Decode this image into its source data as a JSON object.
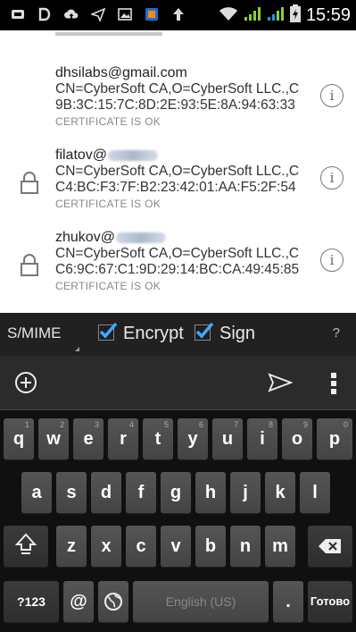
{
  "status_bar": {
    "time": "15:59"
  },
  "certificates": [
    {
      "email_prefix": "dhsilabs@gmail.com",
      "email_redacted": false,
      "has_lock": false,
      "cn": "CN=CyberSoft CA,O=CyberSoft LLC.,C",
      "fingerprint": "9B:3C:15:7C:8D:2E:93:5E:8A:94:63:33",
      "status": "CERTIFICATE IS OK"
    },
    {
      "email_prefix": "filatov@",
      "email_redacted": true,
      "has_lock": true,
      "cn": "CN=CyberSoft CA,O=CyberSoft LLC.,C",
      "fingerprint": "C4:BC:F3:7F:B2:23:42:01:AA:F5:2F:54",
      "status": "CERTIFICATE IS OK"
    },
    {
      "email_prefix": "zhukov@",
      "email_redacted": true,
      "has_lock": true,
      "cn": "CN=CyberSoft CA,O=CyberSoft LLC.,C",
      "fingerprint": "C6:9C:67:C1:9D:29:14:BC:CA:49:45:85",
      "status": "CERTIFICATE IS OK"
    }
  ],
  "smime_bar": {
    "mode_label": "S/MIME",
    "encrypt_label": "Encrypt",
    "encrypt_checked": true,
    "sign_label": "Sign",
    "sign_checked": true,
    "help_label": "?"
  },
  "keyboard": {
    "row1": [
      {
        "label": "q",
        "num": "1"
      },
      {
        "label": "w",
        "num": "2"
      },
      {
        "label": "e",
        "num": "3"
      },
      {
        "label": "r",
        "num": "4"
      },
      {
        "label": "t",
        "num": "5"
      },
      {
        "label": "y",
        "num": "6"
      },
      {
        "label": "u",
        "num": "7"
      },
      {
        "label": "i",
        "num": "8"
      },
      {
        "label": "o",
        "num": "9"
      },
      {
        "label": "p",
        "num": "0"
      }
    ],
    "row2": [
      "a",
      "s",
      "d",
      "f",
      "g",
      "h",
      "j",
      "k",
      "l"
    ],
    "row3": [
      "z",
      "x",
      "c",
      "v",
      "b",
      "n",
      "m"
    ],
    "key_123": "?123",
    "key_at": "@",
    "space_label": "English (US)",
    "key_period": ".",
    "done_label": "Готово"
  },
  "colors": {
    "checkbox_accent": "#3fa9ff",
    "icon_accent": "#2ea8ff",
    "signal_green": "#8ed12b"
  }
}
